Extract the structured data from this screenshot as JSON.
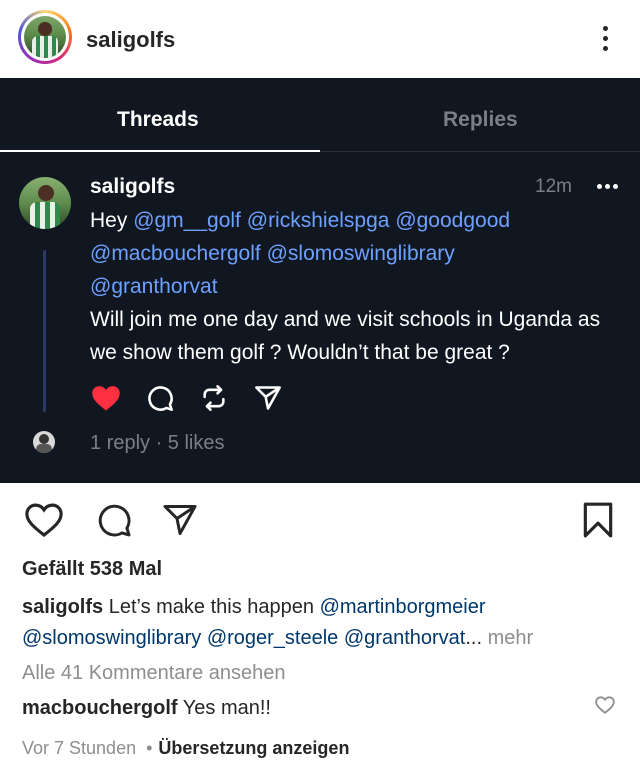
{
  "post_header": {
    "username": "saligolfs",
    "more_icon": "more-vertical-icon"
  },
  "threads_panel": {
    "tabs": [
      {
        "label": "Threads",
        "active": true
      },
      {
        "label": "Replies",
        "active": false
      }
    ],
    "post": {
      "username": "saligolfs",
      "time": "12m",
      "text_prefix": "Hey ",
      "mentions_line": [
        "@gm__golf",
        "@rickshielspga",
        "@goodgood",
        "@macbouchergolf",
        "@slomoswinglibrary",
        "@granthorvat"
      ],
      "body": "Will join me one day and we visit schools in Uganda as we show them golf ? Wouldn’t that be great ?",
      "liked": true,
      "actions": [
        "heart-icon",
        "comment-icon",
        "repost-icon",
        "share-icon"
      ],
      "reply_stats": "1 reply · 5 likes"
    },
    "colors": {
      "background": "#101720",
      "mention": "#6ea0ff",
      "heart": "#ff3040"
    }
  },
  "post_actions": {
    "icons": [
      "like-icon",
      "comment-icon",
      "share-icon",
      "save-icon"
    ]
  },
  "likes": "Gefällt 538 Mal",
  "caption": {
    "username": "saligolfs",
    "text": "Let’s make this happen",
    "mentions": [
      "@martinborgmeier",
      "@slomoswinglibrary",
      "@roger_steele",
      "@granthorvat"
    ],
    "ellipsis": "...",
    "more": "mehr"
  },
  "view_comments": "Alle 41 Kommentare ansehen",
  "comment": {
    "username": "macbouchergolf",
    "text": "Yes man!!"
  },
  "meta": {
    "time": "Vor 7 Stunden",
    "separator": "•",
    "translate": "Übersetzung anzeigen"
  }
}
